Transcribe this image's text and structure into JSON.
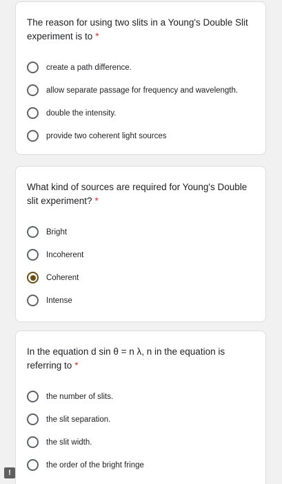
{
  "questions": [
    {
      "title": "The reason for using two slits in a Young's Double Slit experiment is to",
      "required_mark": "*",
      "options": [
        {
          "label": "create a path difference.",
          "selected": false
        },
        {
          "label": "allow separate passage for frequency and wavelength.",
          "selected": false
        },
        {
          "label": "double the intensity.",
          "selected": false
        },
        {
          "label": "provide two coherent light sources",
          "selected": false
        }
      ]
    },
    {
      "title": "What kind of sources are required for Young's Double slit experiment?",
      "required_mark": "*",
      "options": [
        {
          "label": "Bright",
          "selected": false
        },
        {
          "label": "Incoherent",
          "selected": false
        },
        {
          "label": "Coherent",
          "selected": true
        },
        {
          "label": "Intense",
          "selected": false
        }
      ]
    },
    {
      "title": "In the equation d sin θ = n λ, n in the equation is referring to",
      "required_mark": "*",
      "options": [
        {
          "label": "the number of slits.",
          "selected": false
        },
        {
          "label": "the slit separation.",
          "selected": false
        },
        {
          "label": "the slit width.",
          "selected": false
        },
        {
          "label": "the order of the bright fringe",
          "selected": false
        }
      ]
    }
  ],
  "report_button": {
    "label": "!"
  },
  "colors": {
    "background": "#f1f1f1",
    "card": "#ffffff",
    "required": "#d93025",
    "radio_selected": "#6b4e16",
    "radio_unselected": "#5f6368"
  }
}
